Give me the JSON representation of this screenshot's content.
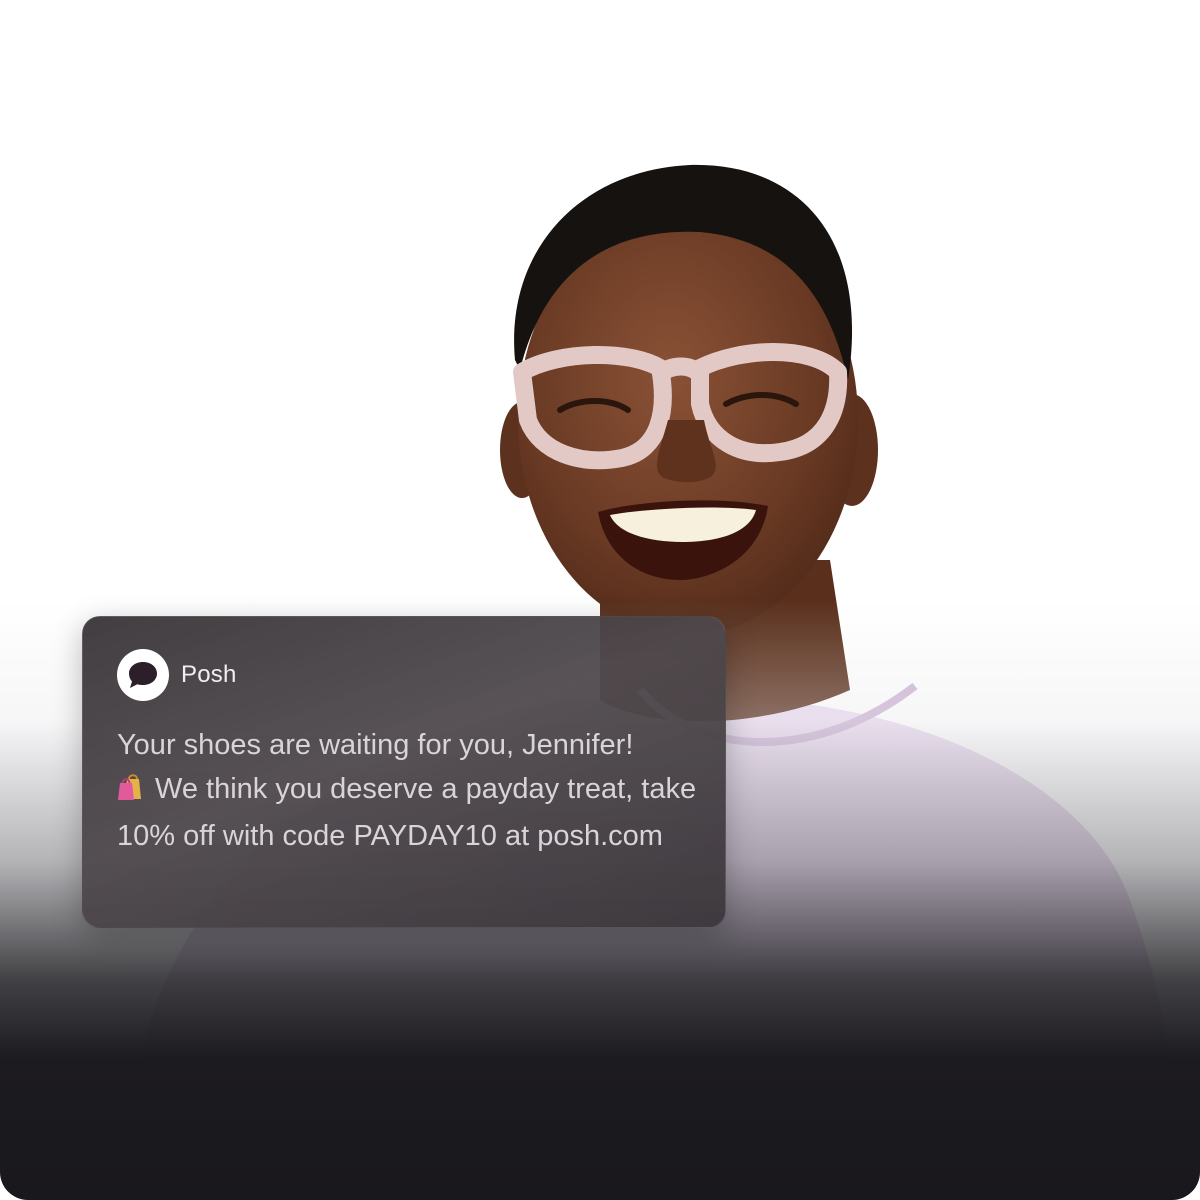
{
  "notification": {
    "app_name": "Posh",
    "app_icon": "chat-bubble-icon",
    "message_line1": "Your shoes are waiting for you, Jennifer!",
    "message_icon": "shopping-bags-icon",
    "message_rest": "We think you deserve a payday treat, take 10% off with code PAYDAY10 at posh.com"
  },
  "colors": {
    "notification_bg": "#3f3a3e",
    "text": "#d9d4d8",
    "app_name": "#f1eef0",
    "shirt": "#e6d7ec",
    "glasses": "#e3c9c6",
    "bottom_fade": "#19181c"
  }
}
